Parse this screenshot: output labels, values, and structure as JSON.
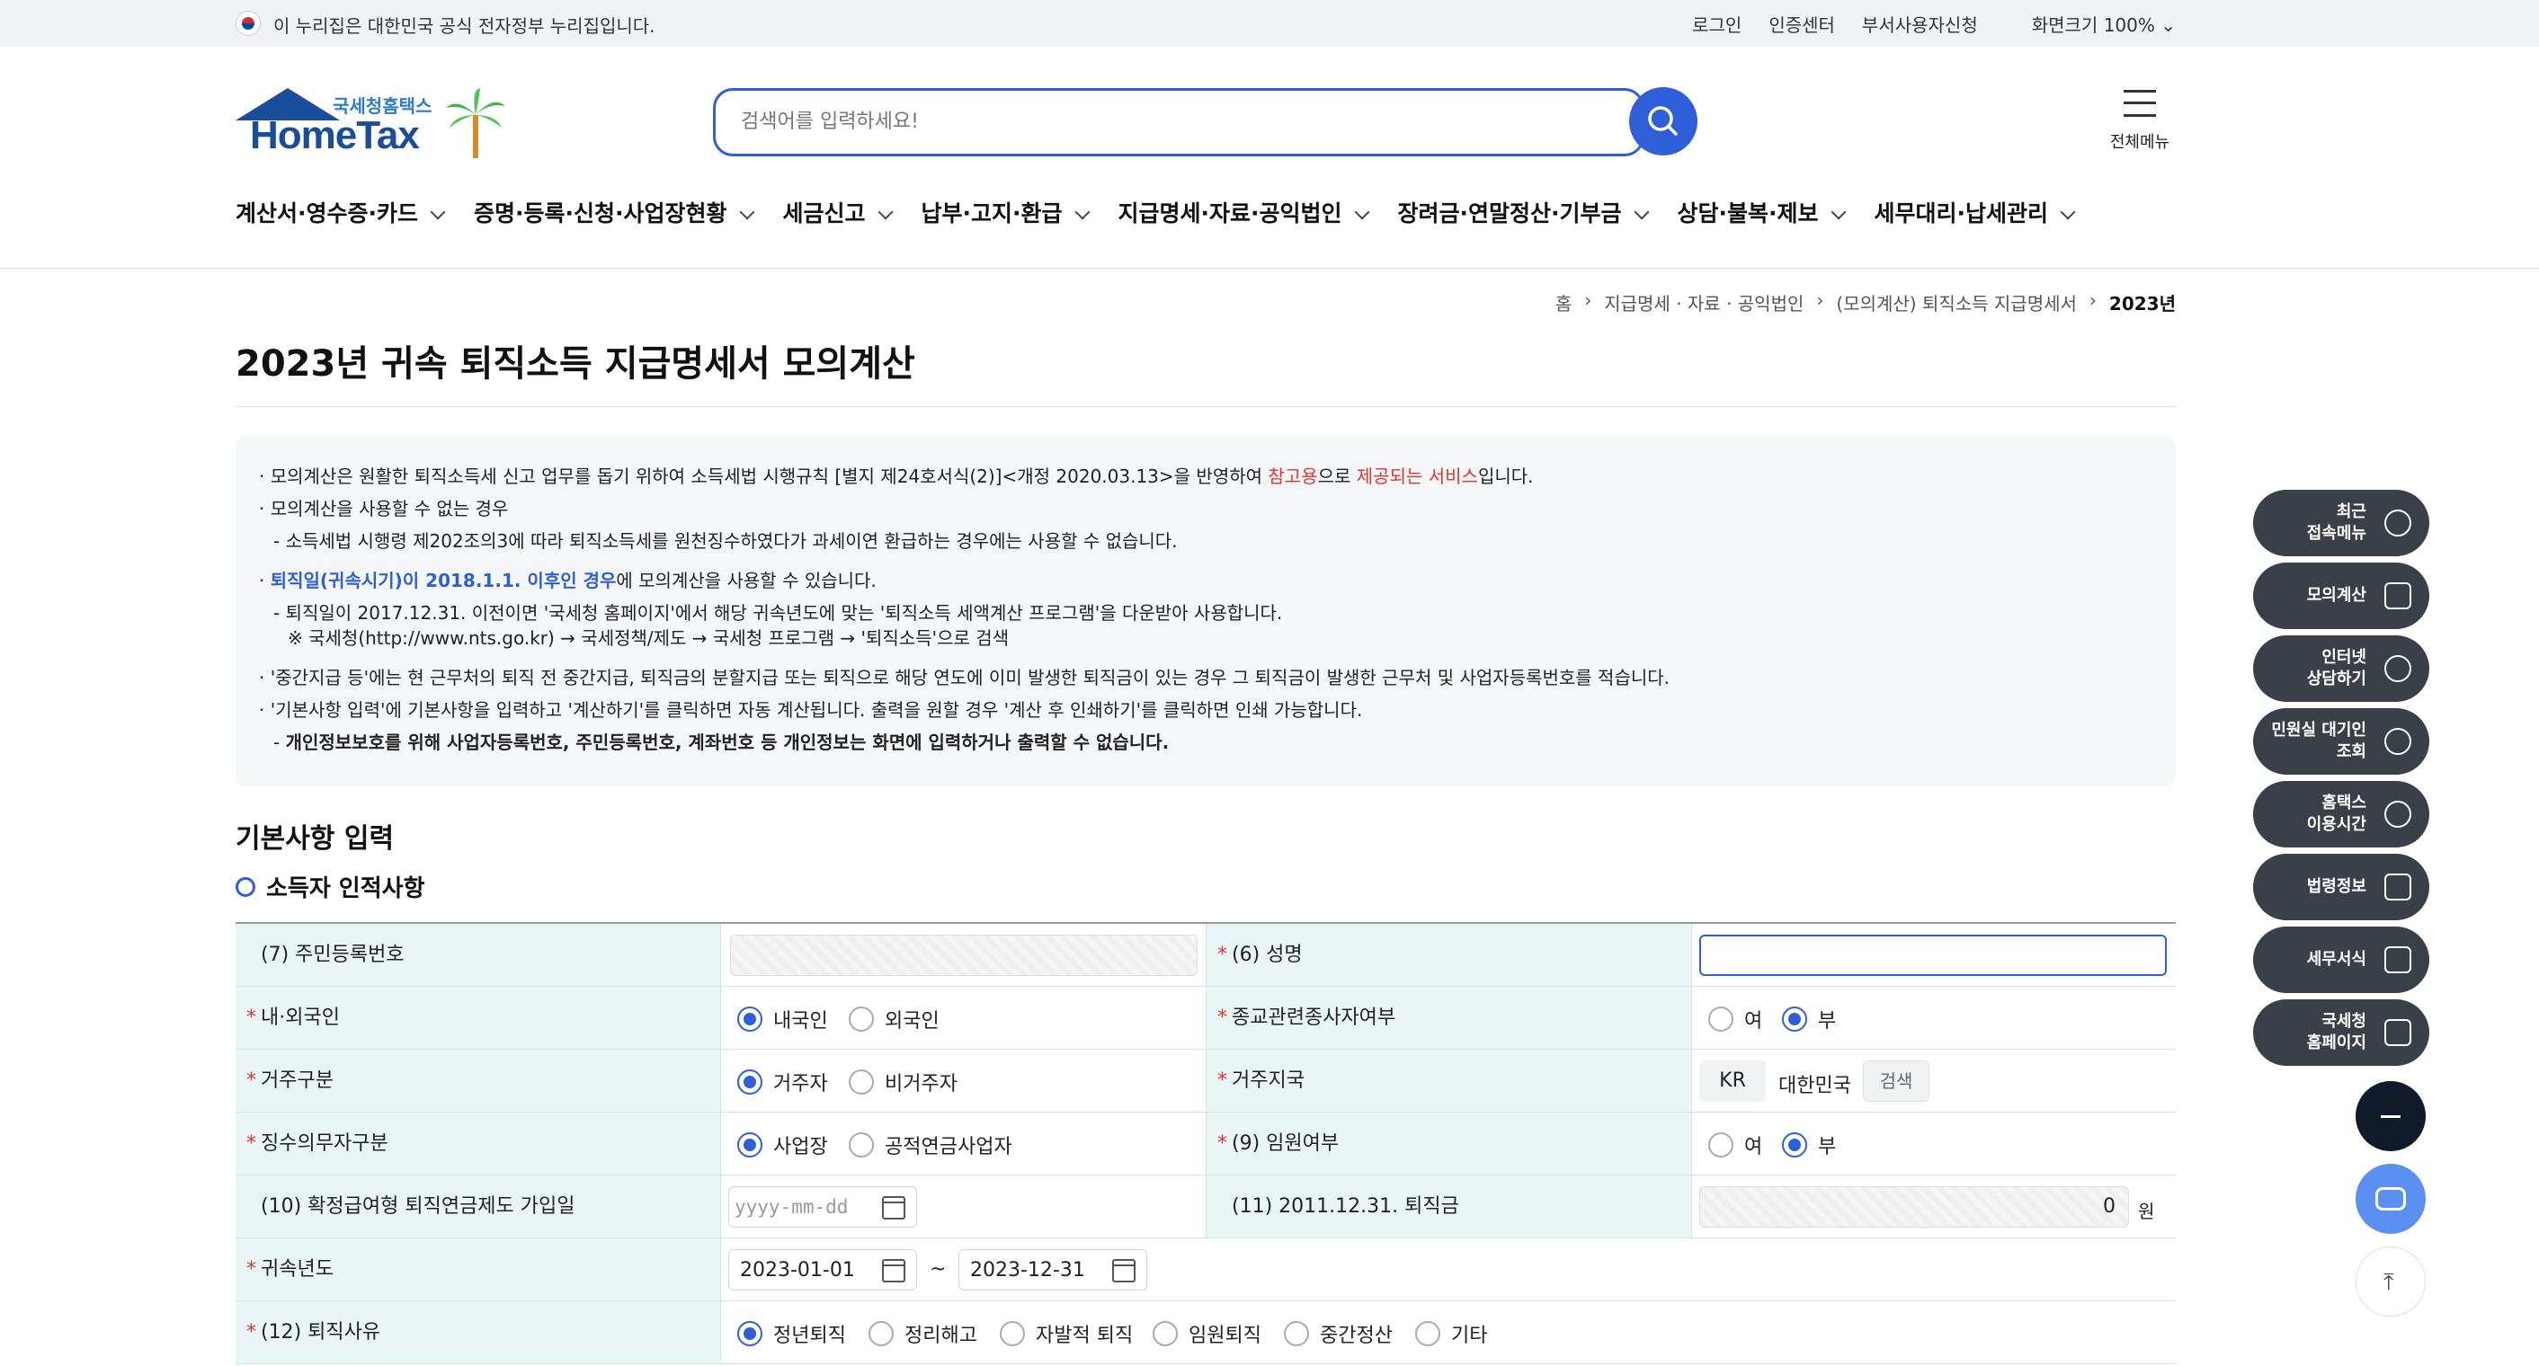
{
  "gov_banner": {
    "text": "이 누리집은 대한민국 공식 전자정부 누리집입니다.",
    "links": [
      "로그인",
      "인증센터",
      "부서사용자신청",
      "화면크기 100%"
    ]
  },
  "logo": {
    "small": "국세청홈택스",
    "big": "HomeTax"
  },
  "search": {
    "placeholder": "검색어를 입력하세요!"
  },
  "menu_all": "전체메뉴",
  "gnb": [
    "계산서·영수증·카드",
    "증명·등록·신청·사업장현황",
    "세금신고",
    "납부·고지·환급",
    "지급명세·자료·공익법인",
    "장려금·연말정산·기부금",
    "상담·불복·제보",
    "세무대리·납세관리"
  ],
  "breadcrumb": [
    "홈",
    "지급명세 · 자료 · 공익법인",
    "(모의계산) 퇴직소득 지급명세서",
    "2023년"
  ],
  "page_title": "2023년 귀속 퇴직소득 지급명세서 모의계산",
  "notice": {
    "l1a": "모의계산은 원활한 퇴직소득세 신고 업무를 돕기 위하여 소득세법 시행규칙 [별지 제24호서식(2)]<개정 2020.03.13>을 반영하여 ",
    "l1b": "참고용",
    "l1c": "으로 ",
    "l1d": "제공되는 서비스",
    "l1e": "입니다.",
    "l2": "모의계산을 사용할 수 없는 경우",
    "l3": "소득세법 시행령 제202조의3에 따라 퇴직소득세를 원천징수하였다가 과세이연 환급하는 경우에는 사용할 수 없습니다.",
    "l4a": "퇴직일(귀속시기)이 2018.1.1. 이후인 경우",
    "l4b": "에 모의계산을 사용할 수 있습니다.",
    "l5": "퇴직일이 2017.12.31. 이전이면 '국세청 홈페이지'에서 해당 귀속년도에 맞는 '퇴직소득 세액계산 프로그램'을 다운받아 사용합니다.",
    "l6": "※ 국세청(http://www.nts.go.kr) → 국세정책/제도 → 국세청 프로그램 → '퇴직소득'으로 검색",
    "l7": "'중간지급 등'에는 현 근무처의 퇴직 전 중간지급, 퇴직금의 분할지급 또는 퇴직으로 해당 연도에 이미 발생한 퇴직금이 있는 경우 그 퇴직금이 발생한 근무처 및 사업자등록번호를 적습니다.",
    "l8": "'기본사항 입력'에 기본사항을 입력하고 '계산하기'를 클릭하면 자동 계산됩니다. 출력을 원할 경우 '계산 후 인쇄하기'를 클릭하면 인쇄 가능합니다.",
    "l9": "개인정보보호를 위해 사업자등록번호, 주민등록번호, 계좌번호 등 개인정보는 화면에 입력하거나 출력할 수 없습니다."
  },
  "section_title": "기본사항 입력",
  "sub_title": "소득자 인적사항",
  "form": {
    "r1": {
      "l1": "(7) 주민등록번호",
      "l2": "(6) 성명"
    },
    "r2": {
      "l1": "내·외국인",
      "o1": "내국인",
      "o2": "외국인",
      "l2": "종교관련종사자여부",
      "o3": "여",
      "o4": "부"
    },
    "r3": {
      "l1": "거주구분",
      "o1": "거주자",
      "o2": "비거주자",
      "l2": "거주지국",
      "code": "KR",
      "country": "대한민국",
      "btn": "검색"
    },
    "r4": {
      "l1": "징수의무자구분",
      "o1": "사업장",
      "o2": "공적연금사업자",
      "l2": "(9) 임원여부",
      "o3": "여",
      "o4": "부"
    },
    "r5": {
      "l1": "(10) 확정급여형 퇴직연금제도 가입일",
      "date_placeholder": "yyyy-mm-dd",
      "l2": "(11) 2011.12.31. 퇴직금",
      "amount": "0",
      "unit": "원"
    },
    "r6": {
      "l1": "귀속년도",
      "from": "2023-01-01",
      "sep": "~",
      "to": "2023-12-31"
    },
    "r7": {
      "l1": "(12) 퇴직사유",
      "opts": [
        "정년퇴직",
        "정리해고",
        "자발적 퇴직",
        "임원퇴직",
        "중간정산",
        "기타"
      ]
    }
  },
  "quick_menu": [
    "최근\n접속메뉴",
    "모의계산",
    "인터넷\n상담하기",
    "민원실 대기인\n조회",
    "홈택스\n이용시간",
    "법령정보",
    "세무서식",
    "국세청\n홈페이지"
  ],
  "colors": {
    "primary": "#2e5fd8",
    "accent_red": "#e0342f",
    "table_head": "#eaf5f5",
    "quick_bg": "#3a3f48"
  }
}
